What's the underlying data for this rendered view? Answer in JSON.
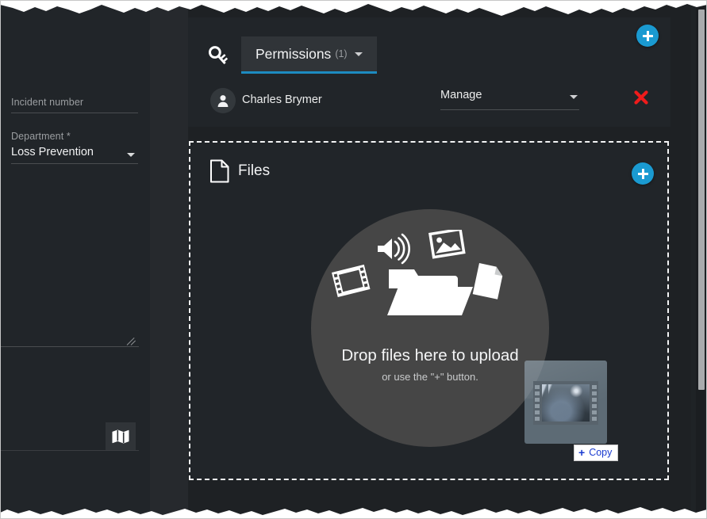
{
  "colors": {
    "accent": "#1a9ad1",
    "tab_underline": "#1d8bc0",
    "delete_red": "#ef1b1b",
    "panel_bg": "#212529",
    "canvas_bg": "#1f2326",
    "drop_circle": "#464646",
    "copy_text": "#1a3bd0"
  },
  "sidebar": {
    "fields": [
      {
        "label": "Incident number",
        "value": "",
        "type": "text"
      },
      {
        "label": "Department *",
        "value": "Loss Prevention",
        "type": "select"
      }
    ],
    "map_button": {
      "icon": "map-icon",
      "label": ""
    }
  },
  "permissions": {
    "icon": "key-icon",
    "tab_label": "Permissions",
    "tab_count": "(1)",
    "add_button_icon": "plus-icon",
    "rows": [
      {
        "avatar_icon": "user-avatar-icon",
        "name": "Charles Brymer",
        "role": "Manage",
        "delete_icon": "close-x-icon"
      }
    ]
  },
  "files": {
    "icon": "file-icon",
    "title": "Files",
    "add_button_icon": "plus-icon",
    "dropzone": {
      "primary_text": "Drop files here to upload",
      "secondary_text": "or use the \"+\" button.",
      "icons": [
        "audio-icon",
        "image-icon",
        "video-icon",
        "folder-icon",
        "document-icon"
      ]
    }
  },
  "drag": {
    "thumbnail_type": "video-thumbnail",
    "badge_text": "Copy",
    "badge_icon": "plus-icon"
  },
  "scrollbar": {
    "name": "vertical-scrollbar"
  }
}
